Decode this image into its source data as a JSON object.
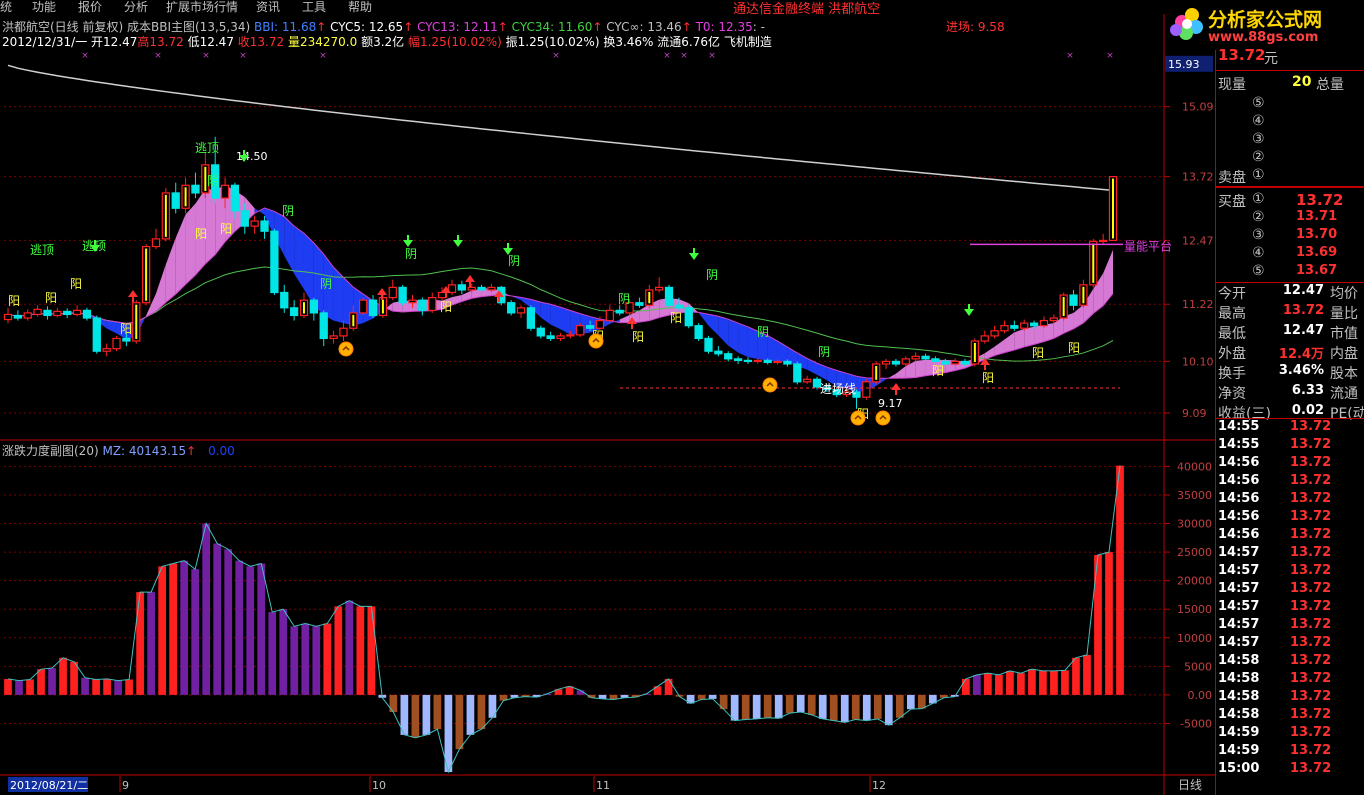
{
  "colors": {
    "up": "#ff2020",
    "down": "#00e5e5",
    "grid": "#800000",
    "axis": "#c00000",
    "pink": "#e080e0",
    "blue": "#2040ff",
    "green_ma": "#50c050",
    "magenta_ma": "#d040d0",
    "white_ma": "#d0d0d0",
    "yellow": "#ffff00",
    "purple_bar": "#7020a0",
    "lightblue_bar": "#a0b8ff",
    "brown_bar": "#a05020"
  },
  "menu": [
    "统",
    "功能",
    "报价",
    "分析",
    "扩展市场行情",
    "资讯",
    "工具",
    "帮助"
  ],
  "window_title": {
    "part1": "通达信金融终端",
    "part2": "洪都航空"
  },
  "logo": {
    "name": "分析家公式网",
    "url": "www.88gs.com"
  },
  "top_info": {
    "name": "洪都航空(日线 前复权) 成本BBI主图(13,5,34)",
    "bbi": "BBI: 11.68",
    "cyc5": "CYC5: 12.65",
    "cyc13": "CYC13: 12.11",
    "cyc34": "CYC34: 11.60",
    "cycinf": "CYC∞: 13.46",
    "t0": "T0: 12.35",
    "t0_suffix": ": -",
    "entry": "进场: 9.58",
    "date": "2012/12/31/一",
    "open": "开12.47",
    "high": "高13.72",
    "low": "低12.47",
    "close": "收13.72",
    "vol": "量234270.0",
    "amount": "额3.2亿",
    "chg": "幅1.25(10.02%)",
    "amp": "振1.25(10.02%)",
    "turnover": "换3.46%",
    "float": "流通6.76亿",
    "sector": "飞机制造"
  },
  "main_axis": {
    "ticks": [
      "15.93",
      "15.09",
      "13.72",
      "12.47",
      "11.22",
      "10.10",
      "9.09"
    ],
    "current": "15.93"
  },
  "main_labels": {
    "escape": "逃顶",
    "yang": "阳",
    "yin": "阴",
    "entry_line": "进场线",
    "peak": "14.50",
    "trough": "9.17",
    "volume_platform": "量能平台"
  },
  "sub_chart": {
    "title": "涨跌力度副图(20)",
    "mz": "MZ: 40143.15",
    "zero": "0.00",
    "ticks": [
      "40000",
      "35000",
      "30000",
      "25000",
      "20000",
      "15000",
      "10000",
      "5000",
      "0.00",
      "-5000"
    ]
  },
  "date_axis": {
    "start": "2012/08/21/二",
    "months": [
      "9",
      "10",
      "11",
      "12"
    ],
    "mode": "日线"
  },
  "right_panel": {
    "price_top": "13.72",
    "price_unit": "元",
    "now_vol_label": "现量",
    "now_vol": "20",
    "total_vol_label": "总量",
    "sell_label": "卖盘",
    "buy_label": "买盘",
    "sell_levels": [
      "⑤",
      "④",
      "③",
      "②",
      "①"
    ],
    "buy_levels": [
      {
        "lvl": "①",
        "price": "13.72"
      },
      {
        "lvl": "②",
        "price": "13.71"
      },
      {
        "lvl": "③",
        "price": "13.70"
      },
      {
        "lvl": "④",
        "price": "13.69"
      },
      {
        "lvl": "⑤",
        "price": "13.67"
      }
    ],
    "stats": [
      {
        "l": "今开",
        "v": "12.47",
        "l2": "均价",
        "c": "#ffffff"
      },
      {
        "l": "最高",
        "v": "13.72",
        "l2": "量比",
        "c": "#ff3030"
      },
      {
        "l": "最低",
        "v": "12.47",
        "l2": "市值",
        "c": "#ffffff"
      },
      {
        "l": "外盘",
        "v": "12.4万",
        "l2": "内盘",
        "c": "#ff3030"
      },
      {
        "l": "换手",
        "v": "3.46%",
        "l2": "股本",
        "c": "#ffffff"
      },
      {
        "l": "净资",
        "v": "6.33",
        "l2": "流通",
        "c": "#ffffff"
      },
      {
        "l": "收益(三)",
        "v": "0.02",
        "l2": "PE(动)",
        "c": "#ffffff"
      }
    ],
    "ticks": [
      {
        "t": "14:55",
        "p": "13.72"
      },
      {
        "t": "14:55",
        "p": "13.72"
      },
      {
        "t": "14:56",
        "p": "13.72"
      },
      {
        "t": "14:56",
        "p": "13.72"
      },
      {
        "t": "14:56",
        "p": "13.72"
      },
      {
        "t": "14:56",
        "p": "13.72"
      },
      {
        "t": "14:56",
        "p": "13.72"
      },
      {
        "t": "14:57",
        "p": "13.72"
      },
      {
        "t": "14:57",
        "p": "13.72"
      },
      {
        "t": "14:57",
        "p": "13.72"
      },
      {
        "t": "14:57",
        "p": "13.72"
      },
      {
        "t": "14:57",
        "p": "13.72"
      },
      {
        "t": "14:57",
        "p": "13.72"
      },
      {
        "t": "14:58",
        "p": "13.72"
      },
      {
        "t": "14:58",
        "p": "13.72"
      },
      {
        "t": "14:58",
        "p": "13.72"
      },
      {
        "t": "14:58",
        "p": "13.72"
      },
      {
        "t": "14:59",
        "p": "13.72"
      },
      {
        "t": "14:59",
        "p": "13.72"
      },
      {
        "t": "15:00",
        "p": "13.72"
      }
    ]
  },
  "chart_data": {
    "type": "candlestick",
    "ylim": [
      8.6,
      16.2
    ],
    "candles": [
      [
        10.92,
        11.02,
        11.15,
        10.85
      ],
      [
        11.0,
        10.95,
        11.1,
        10.9
      ],
      [
        10.95,
        11.05,
        11.12,
        10.9
      ],
      [
        11.02,
        11.12,
        11.2,
        10.98
      ],
      [
        11.1,
        11.0,
        11.18,
        10.92
      ],
      [
        11.0,
        11.08,
        11.15,
        10.96
      ],
      [
        11.08,
        11.02,
        11.14,
        10.95
      ],
      [
        11.02,
        11.1,
        11.2,
        10.98
      ],
      [
        11.1,
        10.95,
        11.15,
        10.9
      ],
      [
        10.95,
        10.3,
        11.0,
        10.25
      ],
      [
        10.3,
        10.35,
        10.45,
        10.2
      ],
      [
        10.35,
        10.55,
        10.6,
        10.3
      ],
      [
        10.55,
        10.5,
        10.65,
        10.4
      ],
      [
        10.5,
        11.25,
        11.3,
        10.45
      ],
      [
        11.25,
        12.35,
        12.4,
        11.2
      ],
      [
        12.35,
        12.5,
        12.7,
        12.3
      ],
      [
        12.5,
        13.4,
        13.5,
        12.45
      ],
      [
        13.4,
        13.1,
        13.6,
        13.0
      ],
      [
        13.1,
        13.55,
        13.7,
        13.0
      ],
      [
        13.55,
        13.4,
        13.8,
        13.3
      ],
      [
        13.4,
        13.95,
        14.2,
        13.3
      ],
      [
        13.95,
        13.3,
        14.5,
        13.2
      ],
      [
        13.3,
        13.55,
        13.7,
        13.1
      ],
      [
        13.55,
        13.05,
        13.6,
        12.9
      ],
      [
        13.05,
        12.75,
        13.2,
        12.6
      ],
      [
        12.75,
        12.85,
        12.95,
        12.6
      ],
      [
        12.85,
        12.65,
        12.95,
        12.5
      ],
      [
        12.65,
        11.45,
        12.7,
        11.4
      ],
      [
        11.45,
        11.15,
        11.6,
        11.05
      ],
      [
        11.15,
        11.0,
        11.3,
        10.9
      ],
      [
        11.0,
        11.3,
        11.45,
        10.95
      ],
      [
        11.3,
        11.05,
        11.35,
        10.9
      ],
      [
        11.05,
        10.55,
        11.1,
        10.4
      ],
      [
        10.55,
        10.6,
        10.7,
        10.45
      ],
      [
        10.6,
        10.75,
        10.9,
        10.5
      ],
      [
        10.75,
        11.05,
        11.2,
        10.7
      ],
      [
        11.05,
        11.3,
        11.35,
        11.0
      ],
      [
        11.3,
        11.0,
        11.4,
        10.95
      ],
      [
        11.0,
        11.35,
        11.5,
        10.95
      ],
      [
        11.35,
        11.55,
        11.7,
        11.3
      ],
      [
        11.55,
        11.25,
        11.6,
        11.2
      ],
      [
        11.25,
        11.3,
        11.4,
        11.15
      ],
      [
        11.3,
        11.1,
        11.35,
        11.0
      ],
      [
        11.1,
        11.35,
        11.45,
        11.05
      ],
      [
        11.35,
        11.45,
        11.55,
        11.3
      ],
      [
        11.45,
        11.6,
        11.7,
        11.4
      ],
      [
        11.6,
        11.5,
        11.68,
        11.42
      ],
      [
        11.5,
        11.55,
        11.62,
        11.45
      ],
      [
        11.55,
        11.5,
        11.6,
        11.45
      ],
      [
        11.5,
        11.55,
        11.62,
        11.46
      ],
      [
        11.55,
        11.25,
        11.58,
        11.2
      ],
      [
        11.25,
        11.05,
        11.3,
        11.0
      ],
      [
        11.05,
        11.15,
        11.2,
        10.95
      ],
      [
        11.15,
        10.75,
        11.2,
        10.7
      ],
      [
        10.75,
        10.6,
        10.8,
        10.55
      ],
      [
        10.6,
        10.55,
        10.68,
        10.5
      ],
      [
        10.55,
        10.6,
        10.66,
        10.5
      ],
      [
        10.6,
        10.62,
        10.7,
        10.55
      ],
      [
        10.62,
        10.8,
        10.85,
        10.58
      ],
      [
        10.8,
        10.75,
        10.9,
        10.7
      ],
      [
        10.75,
        10.9,
        10.98,
        10.72
      ],
      [
        10.9,
        11.1,
        11.2,
        10.85
      ],
      [
        11.1,
        11.05,
        11.2,
        11.0
      ],
      [
        11.05,
        11.25,
        11.32,
        11.0
      ],
      [
        11.25,
        11.2,
        11.35,
        11.15
      ],
      [
        11.2,
        11.5,
        11.6,
        11.15
      ],
      [
        11.5,
        11.55,
        11.75,
        11.45
      ],
      [
        11.55,
        11.2,
        11.6,
        11.15
      ],
      [
        11.2,
        11.15,
        11.35,
        11.1
      ],
      [
        11.15,
        10.8,
        11.2,
        10.75
      ],
      [
        10.8,
        10.55,
        10.85,
        10.5
      ],
      [
        10.55,
        10.3,
        10.6,
        10.25
      ],
      [
        10.3,
        10.25,
        10.4,
        10.2
      ],
      [
        10.25,
        10.15,
        10.3,
        10.1
      ],
      [
        10.15,
        10.12,
        10.2,
        10.05
      ],
      [
        10.12,
        10.1,
        10.18,
        10.05
      ],
      [
        10.1,
        10.12,
        10.16,
        10.06
      ],
      [
        10.12,
        10.08,
        10.16,
        10.04
      ],
      [
        10.08,
        10.1,
        10.14,
        10.04
      ],
      [
        10.1,
        10.05,
        10.14,
        10.0
      ],
      [
        10.05,
        9.7,
        10.1,
        9.65
      ],
      [
        9.7,
        9.75,
        9.82,
        9.66
      ],
      [
        9.75,
        9.6,
        9.8,
        9.55
      ],
      [
        9.6,
        9.55,
        9.65,
        9.5
      ],
      [
        9.55,
        9.45,
        9.6,
        9.4
      ],
      [
        9.45,
        9.5,
        9.55,
        9.4
      ],
      [
        9.5,
        9.4,
        9.55,
        9.17
      ],
      [
        9.4,
        9.7,
        9.75,
        9.35
      ],
      [
        9.7,
        10.05,
        10.1,
        9.65
      ],
      [
        10.05,
        10.1,
        10.15,
        9.95
      ],
      [
        10.1,
        10.05,
        10.15,
        10.0
      ],
      [
        10.05,
        10.15,
        10.2,
        10.0
      ],
      [
        10.15,
        10.2,
        10.28,
        10.1
      ],
      [
        10.2,
        10.15,
        10.25,
        10.1
      ],
      [
        10.15,
        10.1,
        10.2,
        10.05
      ],
      [
        10.1,
        10.05,
        10.15,
        10.0
      ],
      [
        10.05,
        10.1,
        10.16,
        10.02
      ],
      [
        10.1,
        10.05,
        10.15,
        10.0
      ],
      [
        10.05,
        10.5,
        10.55,
        10.0
      ],
      [
        10.5,
        10.6,
        10.7,
        10.45
      ],
      [
        10.6,
        10.7,
        10.8,
        10.55
      ],
      [
        10.7,
        10.8,
        10.9,
        10.65
      ],
      [
        10.8,
        10.75,
        10.9,
        10.7
      ],
      [
        10.75,
        10.85,
        10.92,
        10.7
      ],
      [
        10.85,
        10.8,
        10.9,
        10.74
      ],
      [
        10.8,
        10.9,
        10.98,
        10.76
      ],
      [
        10.9,
        10.95,
        11.02,
        10.85
      ],
      [
        10.95,
        11.4,
        11.45,
        10.9
      ],
      [
        11.4,
        11.2,
        11.5,
        11.1
      ],
      [
        11.2,
        11.6,
        11.7,
        11.15
      ],
      [
        11.6,
        12.45,
        12.5,
        11.55
      ],
      [
        12.45,
        12.47,
        12.6,
        12.4
      ],
      [
        12.47,
        13.72,
        13.72,
        12.47
      ]
    ],
    "sub_values": [
      2800,
      2500,
      2700,
      4500,
      4700,
      6500,
      5800,
      3000,
      2700,
      2800,
      2500,
      2700,
      18000,
      18000,
      22500,
      23000,
      23500,
      22000,
      30000,
      26500,
      25500,
      23500,
      22500,
      23000,
      14500,
      15000,
      12000,
      12500,
      12000,
      12500,
      15500,
      16500,
      15500,
      15500,
      -500,
      -3000,
      -7000,
      -7500,
      -7000,
      -6000,
      -13500,
      -9500,
      -7000,
      -6000,
      -4000,
      -1000,
      -500,
      -300,
      -400,
      200,
      1000,
      1500,
      800,
      -500,
      -700,
      -800,
      -500,
      -400,
      200,
      1500,
      2800,
      -300,
      -1500,
      -800,
      -700,
      -2500,
      -4500,
      -4300,
      -4200,
      -4000,
      -4100,
      -3200,
      -3000,
      -3500,
      -4200,
      -4500,
      -4800,
      -4300,
      -4500,
      -4200,
      -5300,
      -4000,
      -2500,
      -2400,
      -1500,
      -500,
      -300,
      2800,
      3500,
      3800,
      3500,
      4200,
      3800,
      4500,
      4200,
      4200,
      4300,
      6500,
      7000,
      24500,
      25000,
      40143
    ]
  }
}
